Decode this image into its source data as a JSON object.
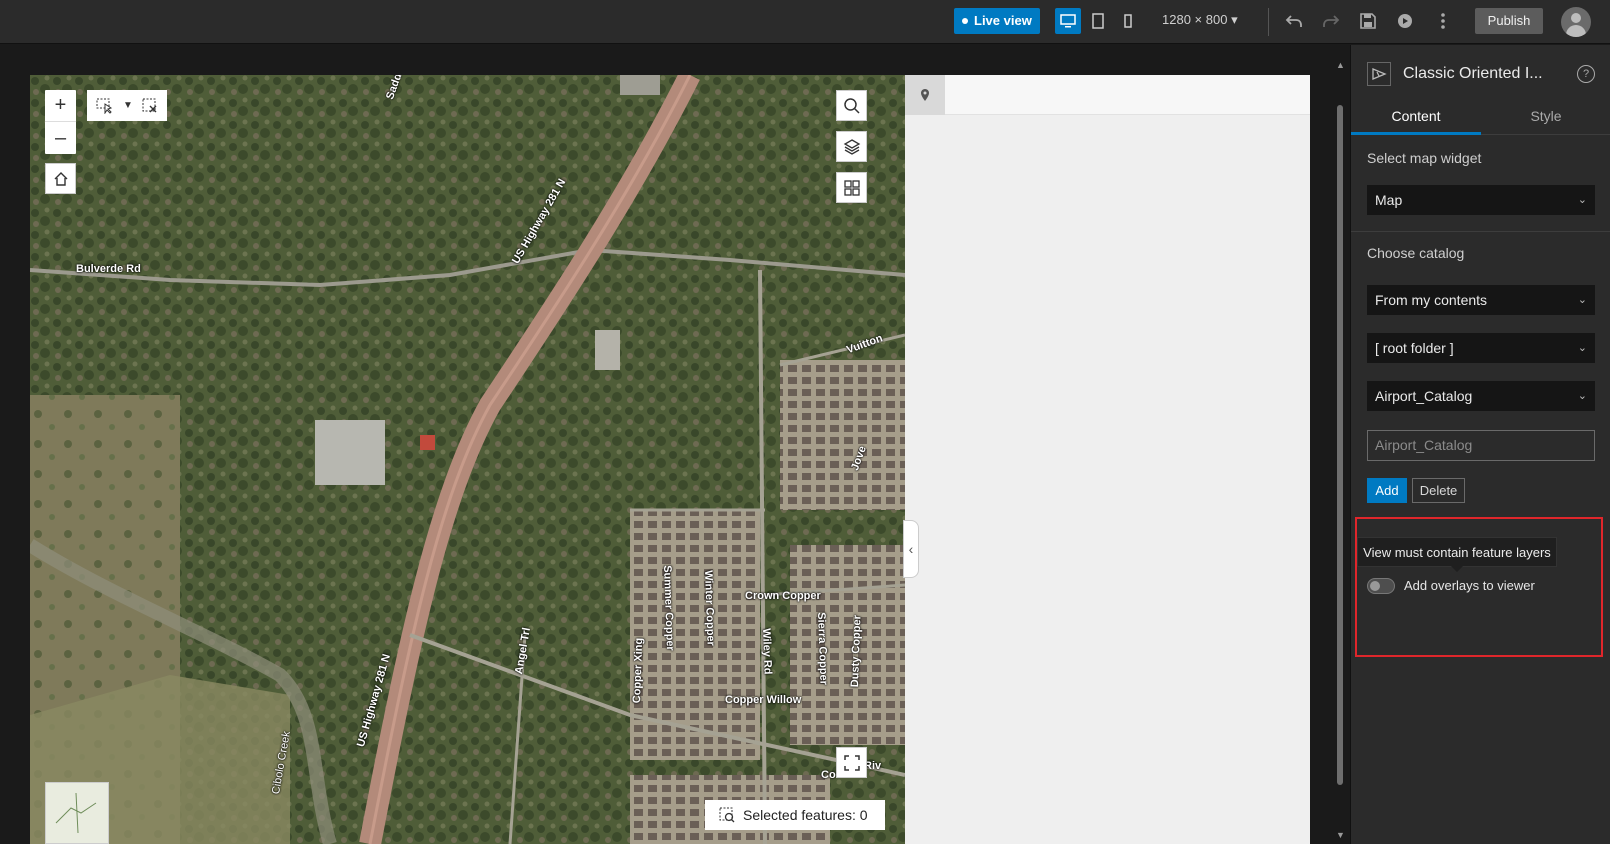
{
  "toolbar": {
    "live_view": "Live view",
    "resolution": "1280 × 800",
    "publish": "Publish",
    "icons": [
      "desktop-icon",
      "tablet-icon",
      "phone-icon",
      "undo-icon",
      "redo-icon",
      "save-icon",
      "preview-icon",
      "more-icon",
      "avatar-icon"
    ]
  },
  "map": {
    "road_labels": {
      "bulverde": "Bulverde Rd",
      "hwy_north": "US Highway 281 N",
      "hwy_south": "US Highway 281 N",
      "angel": "Angel Trl",
      "summer": "Summer Copper",
      "winter": "Winter Copper",
      "crown": "Crown Copper",
      "wiley": "Wiley Rd",
      "sierra": "Sierra Copper",
      "dusty": "Dusty Copper",
      "copper_xing": "Copper Xing",
      "copper_willow": "Copper Willow",
      "vuitton": "Vuitton",
      "jove": "Jove",
      "cibolo": "Cibolo Creek",
      "corner": "Co",
      "corner2": "Riv",
      "sadd": "Sadd"
    },
    "zoom_in": "+",
    "zoom_out": "–",
    "selected_features": "Selected features: 0"
  },
  "panel": {
    "title": "Classic Oriented I...",
    "tabs": [
      "Content",
      "Style"
    ],
    "select_map_label": "Select map widget",
    "map_value": "Map",
    "choose_catalog_label": "Choose catalog",
    "catalog_source": "From my contents",
    "folder": "[ root folder ]",
    "catalog": "Airport_Catalog",
    "catalog_input_placeholder": "Airport_Catalog",
    "add": "Add",
    "delete": "Delete",
    "tooltip": "View must contain feature layers",
    "toggle_label": "Add overlays to viewer"
  }
}
